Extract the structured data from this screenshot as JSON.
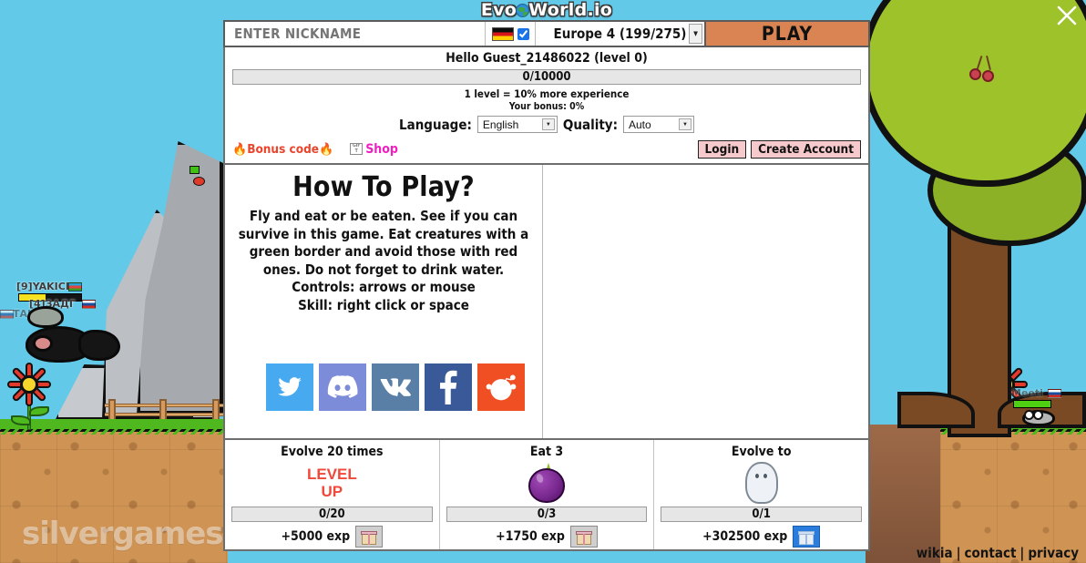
{
  "window": {
    "close_label": "×",
    "site_links": [
      "wikia",
      "contact",
      "privacy"
    ],
    "separator": "|",
    "watermark": "silvergames.c"
  },
  "logo": {
    "before": "Evo",
    "globe": "O",
    "after": "World.io"
  },
  "top_bar": {
    "nickname_placeholder": "ENTER NICKNAME",
    "nickname_value": "",
    "flag": "de-flag-icon",
    "flag_checked": true,
    "server": "Europe 4 (199/275)",
    "server_options": [
      "Europe 4 (199/275)"
    ],
    "play_label": "PLAY"
  },
  "account": {
    "greeting": "Hello Guest_21486022 (level 0)",
    "xp_text": "0/10000",
    "xp_percent": 0,
    "level_note": "1 level = 10% more experience",
    "bonus_note": "Your bonus: 0%",
    "language_label": "Language:",
    "language_value": "English",
    "quality_label": "Quality:",
    "quality_value": "Auto",
    "bonus_code_label": "Bonus code",
    "fire_glyph": "🔥",
    "shop_label": "Shop",
    "login_label": "Login",
    "create_account_label": "Create Account"
  },
  "how_to_play": {
    "title": "How To Play?",
    "body": "Fly and eat or be eaten. See if you can survive in this game. Eat creatures with a green border and avoid those with red ones. Do not forget to drink water.",
    "controls": "Controls: arrows or mouse",
    "skill": "Skill: right click or space"
  },
  "social": [
    {
      "name": "twitter",
      "label": "Twitter",
      "color": "#47a9ef"
    },
    {
      "name": "discord",
      "label": "Discord",
      "color": "#7d8cd8"
    },
    {
      "name": "vk",
      "label": "VK",
      "color": "#5a7fa6"
    },
    {
      "name": "facebook",
      "label": "Facebook",
      "color": "#3a5998"
    },
    {
      "name": "reddit",
      "label": "Reddit",
      "color": "#f04f23"
    }
  ],
  "quests": [
    {
      "title": "Evolve 20 times",
      "art": "level-up-text",
      "art_text_line1": "LEVEL",
      "art_text_line2": "UP",
      "progress": "0/20",
      "progress_percent": 0,
      "reward": "+5000 exp",
      "claim_icon": "gift-icon",
      "claim_state": "disabled"
    },
    {
      "title": "Eat 3",
      "art": "purple-fruit-icon",
      "progress": "0/3",
      "progress_percent": 0,
      "reward": "+1750 exp",
      "claim_icon": "gift-icon",
      "claim_state": "disabled"
    },
    {
      "title": "Evolve to",
      "art": "ghost-creature-icon",
      "progress": "0/1",
      "progress_percent": 0,
      "reward": "+302500 exp",
      "claim_icon": "gift-icon",
      "claim_state": "active"
    }
  ],
  "scene": {
    "players": [
      {
        "name": "[9]YAKICI",
        "flag": "az",
        "hp_percent": 42
      },
      {
        "name": "[4]ЗАДГ",
        "flag": "ru",
        "hp_percent": 0
      },
      {
        "name": "ТАК",
        "flag": "ru",
        "hp_percent": 0
      },
      {
        "name": "Meeti",
        "flag": "ru",
        "hp_percent": 100
      }
    ]
  },
  "colors": {
    "sky": "#63c9e8",
    "play_button": "#d98452",
    "grass": "#4fb81e",
    "dirt": "#cf9354",
    "level_up_red": "#f0483a",
    "shop_pink": "#f020c0",
    "bonus_orange": "#e8452c"
  }
}
